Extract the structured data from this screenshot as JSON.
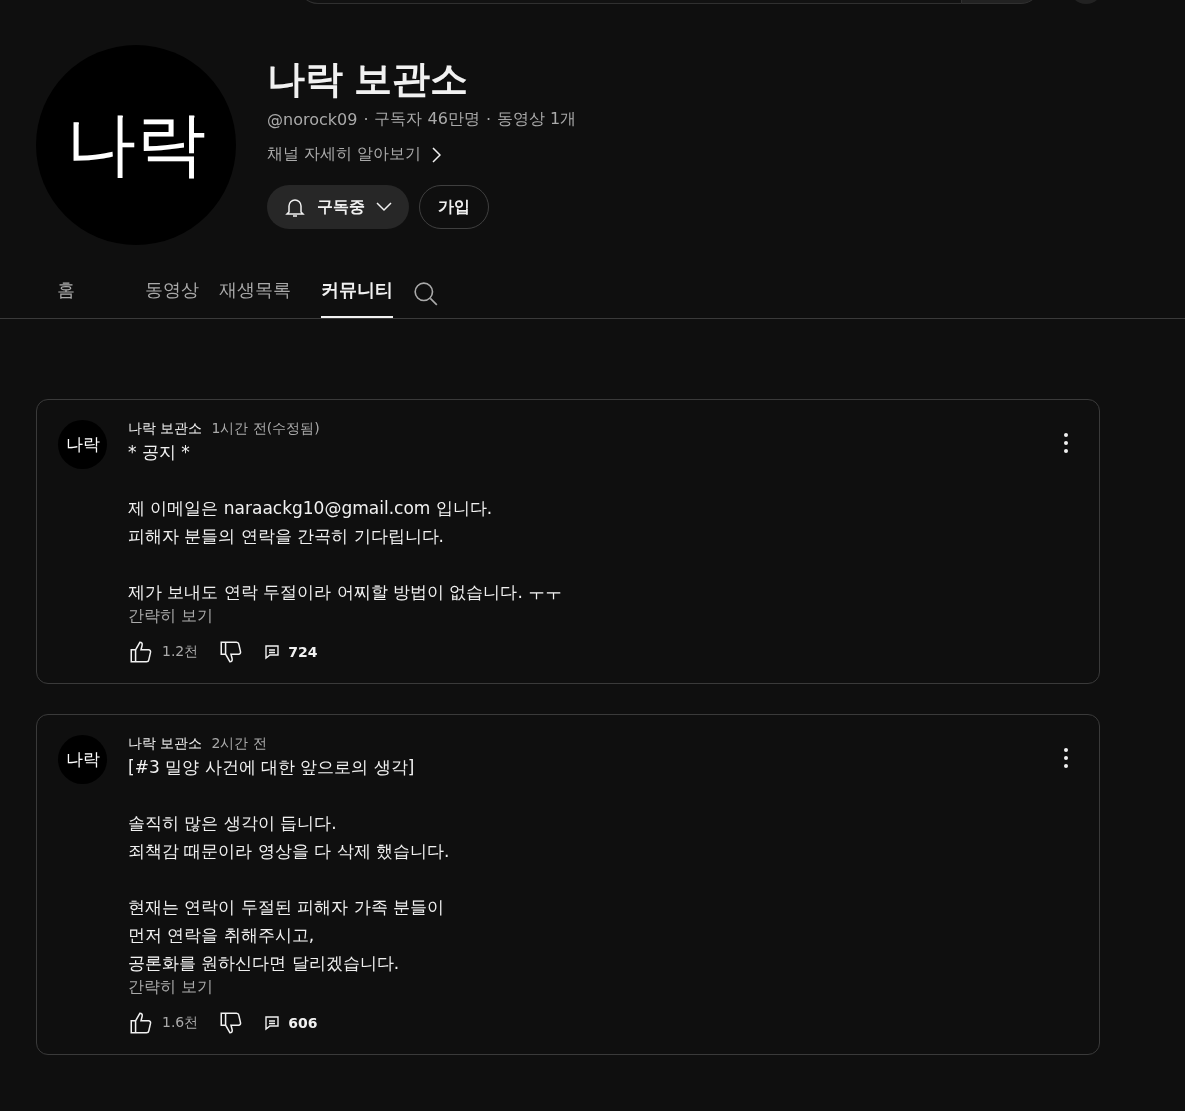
{
  "channel": {
    "avatar_text": "나락",
    "name": "나락 보관소",
    "handle": "@norock09",
    "separators": [
      "·",
      "·"
    ],
    "subscribers": "구독자 46만명",
    "videos": "동영상 1개",
    "about_link": "채널 자세히 알아보기",
    "subscribe_button": "구독중",
    "join_button": "가입"
  },
  "tabs": [
    {
      "label": "홈",
      "selected": false
    },
    {
      "label": "동영상",
      "selected": false
    },
    {
      "label": "재생목록",
      "selected": false
    },
    {
      "label": "커뮤니티",
      "selected": true
    }
  ],
  "posts": [
    {
      "avatar_text": "나락",
      "author": "나락 보관소",
      "time": "1시간 전(수정됨)",
      "paragraphs": [
        [
          "* 공지 *"
        ],
        [
          "제 이메일은 naraackg10@gmail.com 입니다.",
          "피해자 분들의 연락을 간곡히 기다립니다."
        ],
        [
          "제가 보내도 연락 두절이라 어찌할 방법이 없습니다. ㅜㅜ"
        ]
      ],
      "collapse_link": "간략히 보기",
      "likes": "1.2천",
      "comments": "724"
    },
    {
      "avatar_text": "나락",
      "author": "나락 보관소",
      "time": "2시간 전",
      "paragraphs": [
        [
          "[#3 밀양 사건에 대한 앞으로의 생각]"
        ],
        [
          "솔직히 많은 생각이 듭니다.",
          "죄책감 때문이라 영상을 다 삭제 했습니다."
        ],
        [
          "현재는 연락이 두절된 피해자 가족 분들이",
          "먼저 연락을 취해주시고,",
          "공론화를 원하신다면 달리겠습니다."
        ]
      ],
      "collapse_link": "간략히 보기",
      "likes": "1.6천",
      "comments": "606"
    }
  ]
}
